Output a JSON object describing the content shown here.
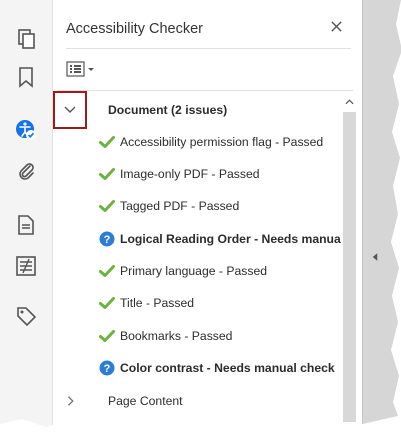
{
  "panel": {
    "title": "Accessibility Checker"
  },
  "tree": {
    "items": [
      {
        "label": "Document (2 issues)",
        "status": "expanded"
      },
      {
        "label": "Accessibility permission flag - Passed",
        "status": "passed"
      },
      {
        "label": "Image-only PDF - Passed",
        "status": "passed"
      },
      {
        "label": "Tagged PDF - Passed",
        "status": "passed"
      },
      {
        "label": "Logical Reading Order - Needs manual check",
        "status": "manual"
      },
      {
        "label": "Primary language - Passed",
        "status": "passed"
      },
      {
        "label": "Title - Passed",
        "status": "passed"
      },
      {
        "label": "Bookmarks - Passed",
        "status": "passed"
      },
      {
        "label": "Color contrast - Needs manual check",
        "status": "manual"
      },
      {
        "label": "Page Content",
        "status": "collapsed"
      }
    ]
  },
  "colors": {
    "highlight_border": "#9e1b1b",
    "pass_green": "#6cb33e",
    "help_blue": "#2d7dd2",
    "accessibility_tool_blue": "#1473e6"
  },
  "icons": {
    "tool_organize": "pages-icon",
    "tool_bookmarks": "bookmark-icon",
    "tool_accessibility": "accessibility-icon",
    "tool_attachments": "paperclip-icon",
    "tool_content": "document-icon",
    "tool_compare": "compare-icon",
    "tool_tags": "tag-icon",
    "close": "close-icon",
    "options": "options-menu-icon",
    "pass": "checkmark-icon",
    "manual": "question-icon"
  }
}
